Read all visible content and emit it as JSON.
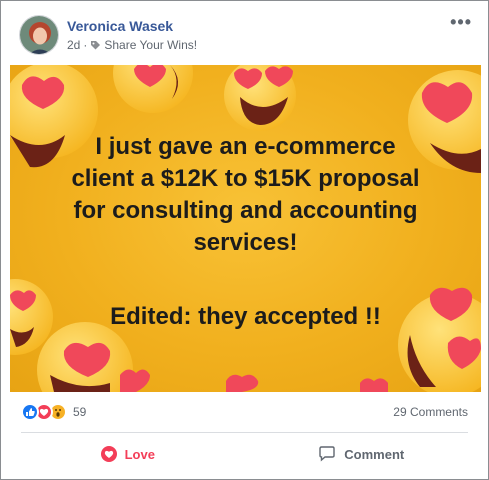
{
  "post": {
    "author": "Veronica Wasek",
    "time": "2d",
    "separator": "·",
    "group": "Share Your Wins!",
    "more_label": "•••"
  },
  "banner": {
    "background_color": "#f1b01e",
    "text_lines": [
      "I just gave an e-commerce",
      "client a $12K to $15K proposal",
      "for consulting and accounting",
      "services!"
    ],
    "edited_line": "Edited: they accepted !!"
  },
  "engagement": {
    "reaction_icons": [
      "like-reaction-icon",
      "love-reaction-icon",
      "wow-reaction-icon"
    ],
    "reaction_count": "59",
    "comments": "29 Comments"
  },
  "actions": {
    "love_label": "Love",
    "comment_label": "Comment"
  },
  "colors": {
    "name": "#385898",
    "love": "#f33e58",
    "like": "#1877f2",
    "wow": "#f7b125"
  }
}
